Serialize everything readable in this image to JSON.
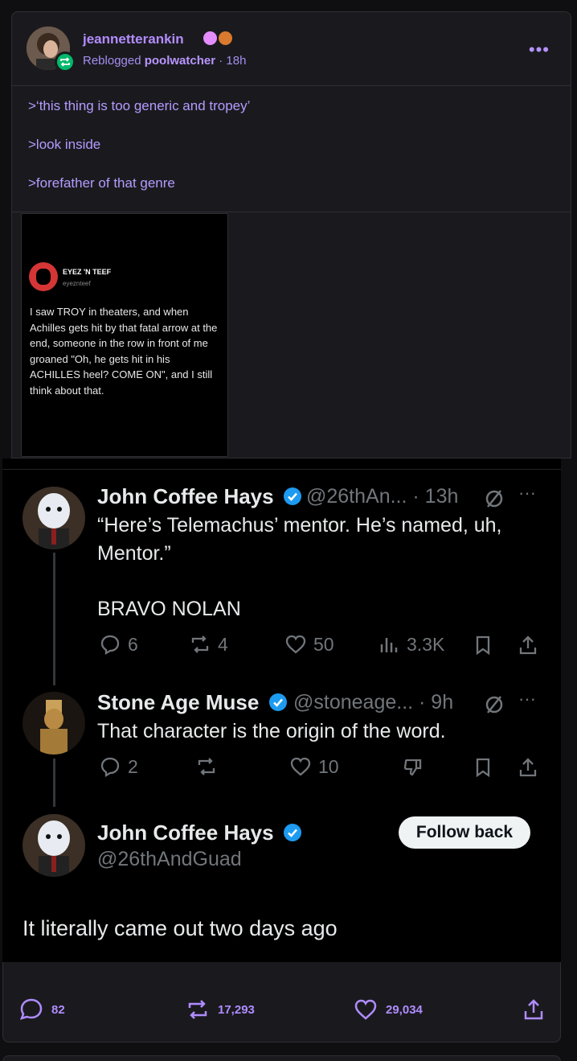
{
  "post": {
    "username": "jeannetterankin",
    "reblog_label": "Reblogged",
    "reblog_from": "poolwatcher",
    "time": "· 18h",
    "more": "•••",
    "lines": [
      ">‘this thing is too generic and tropey’",
      ">look inside",
      ">forefather of that genre"
    ]
  },
  "embedded_tweet": {
    "name": "EYEZ 'N TEEF",
    "handle": "eyeznteef",
    "text": "I saw TROY in theaters, and when Achilles gets hit by that fatal arrow at the end, someone in the row in front of me groaned \"Oh, he gets hit in his ACHILLES heel? COME ON\", and I still think about that."
  },
  "thread": {
    "tweet1": {
      "name": "John Coffee Hays",
      "meta": "@26thAn... · 13h",
      "text1": "“Here’s Telemachus’ mentor. He’s named, uh, Mentor.”",
      "text2": "BRAVO NOLAN",
      "replies": "6",
      "reposts": "4",
      "likes": "50",
      "views": "3.3K"
    },
    "tweet2": {
      "name": "Stone Age Muse",
      "meta": "@stoneage... · 9h",
      "text": "That character is the origin of the word.",
      "replies": "2",
      "likes": "10"
    },
    "tweet3": {
      "name": "John Coffee Hays",
      "handle": "@26thAndGuad",
      "follow_label": "Follow back",
      "text": "It literally came out two days ago"
    }
  },
  "footer": {
    "comments": "82",
    "reblogs": "17,293",
    "likes": "29,034"
  },
  "colors": {
    "accent": "#b38cff",
    "reblog_green": "#00b96b",
    "verified_blue": "#1d9bf0"
  }
}
